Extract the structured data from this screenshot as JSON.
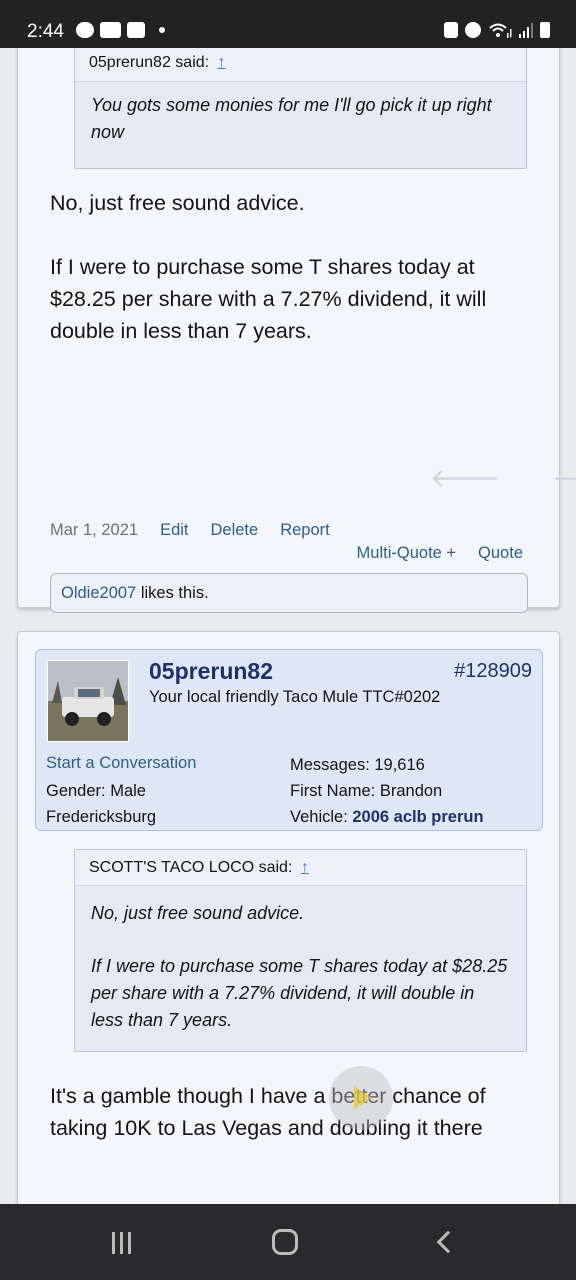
{
  "status_bar": {
    "time": "2:44",
    "icons_left": [
      "chat-icon",
      "bh-icon",
      "image-icon",
      "dot-icon"
    ],
    "icons_right": [
      "battery-saver-icon",
      "alarm-icon",
      "wifi-icon",
      "signal-icon",
      "battery-icon"
    ]
  },
  "post1": {
    "quote": {
      "author": "05prerun82 said:",
      "arrow": "↑",
      "text": "You gots some monies for me I'll go pick it up right now"
    },
    "message": {
      "p1": "No, just free sound advice.",
      "p2": "If I were to purchase some T shares today at $28.25 per share with a 7.27% dividend, it will double in less than 7 years."
    },
    "date": "Mar 1, 2021",
    "actions": {
      "edit": "Edit",
      "delete": "Delete",
      "report": "Report",
      "multiquote": "Multi-Quote +",
      "quote": "Quote"
    },
    "likes": {
      "user": "Oldie2007",
      "text": " likes this."
    }
  },
  "post2": {
    "user": {
      "name": "05prerun82",
      "post_number": "#128909",
      "title": "Your local friendly Taco Mule TTC#0202",
      "start_conversation": "Start a Conversation",
      "gender": "Gender:  Male",
      "location": "Fredericksburg",
      "messages": "Messages:  19,616",
      "first_name": "First Name:  Brandon",
      "vehicle_label": "Vehicle:  ",
      "vehicle": "2006 aclb prerun"
    },
    "quote": {
      "author": "SCOTT'S TACO LOCO said:",
      "arrow": "↑",
      "p1": "No, just free sound advice.",
      "p2": "If I were to purchase some T shares today at $28.25 per share with a 7.27% dividend, it will double in less than 7 years."
    },
    "message": "It's a gamble though I have a better chance of taking 10K to Las Vegas and doubling it there"
  },
  "nav": {
    "icons": [
      "recent-apps-icon",
      "home-icon",
      "back-icon"
    ]
  }
}
